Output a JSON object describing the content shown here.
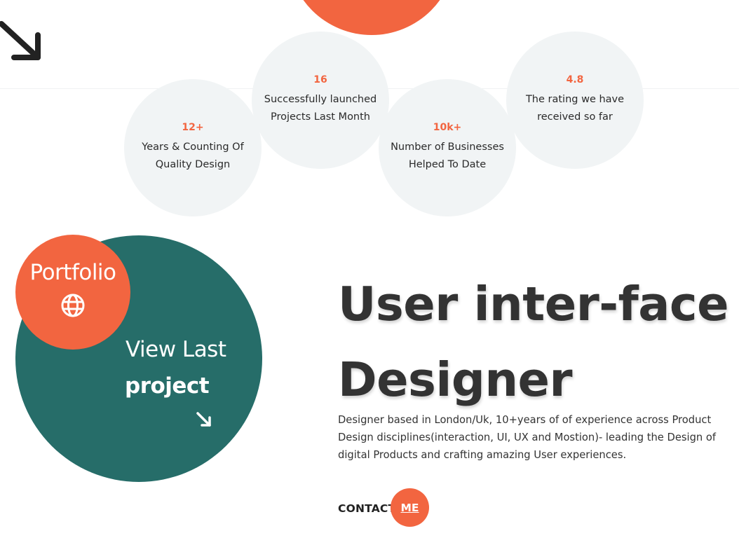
{
  "stats": [
    {
      "value": "12+",
      "label": "Years & Counting Of Quality Design"
    },
    {
      "value": "16",
      "label": "Successfully launched Projects Last Month"
    },
    {
      "value": "10k+",
      "label": "Number of Businesses Helped To Date"
    },
    {
      "value": "4.8",
      "label": "The rating we have received so far"
    }
  ],
  "portfolio": {
    "label": "Portfolio",
    "icon": "globe-icon",
    "view_last": "View Last",
    "project": "project",
    "arrow_icon": "arrow-down-right-icon"
  },
  "hero": {
    "title_line1": "User inter-face",
    "title_line2": "Designer",
    "description": "Designer based in London/Uk, 10+years of of experience across Product Design disciplines(interaction, UI, UX and Mostion)- leading the Design of digital Products and crafting amazing User experiences."
  },
  "contact": {
    "label": "CONTACT",
    "me": "ME"
  },
  "colors": {
    "accent": "#f26540",
    "teal": "#266d69",
    "stat_bg": "#f1f4f5"
  }
}
